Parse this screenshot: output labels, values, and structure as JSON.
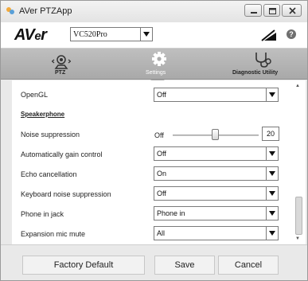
{
  "window": {
    "title": "AVer PTZApp"
  },
  "header": {
    "logo": {
      "main": "AV",
      "small": "e",
      "tail": "r"
    },
    "device": "VC520Pro",
    "help": "?"
  },
  "tabs": [
    {
      "label": "PTZ",
      "icon": "camera-ptz-icon",
      "active": false
    },
    {
      "label": "Settings",
      "icon": "gear-icon",
      "active": true
    },
    {
      "label": "Diagnostic Utility",
      "icon": "stethoscope-icon",
      "active": false
    }
  ],
  "settings": {
    "opengl": {
      "label": "OpenGL",
      "value": "Off"
    },
    "speakerphone_title": "Speakerphone",
    "noise": {
      "label": "Noise suppression",
      "min_label": "Off",
      "value": "20"
    },
    "agc": {
      "label": "Automatically gain control",
      "value": "Off"
    },
    "echo": {
      "label": "Echo cancellation",
      "value": "On"
    },
    "keyboard": {
      "label": "Keyboard noise suppression",
      "value": "Off"
    },
    "phone_jack": {
      "label": "Phone in jack",
      "value": "Phone in"
    },
    "exp_mic": {
      "label": "Expansion mic mute",
      "value": "All"
    }
  },
  "footer": {
    "factory_default": "Factory Default",
    "save": "Save",
    "cancel": "Cancel"
  },
  "colors": {
    "tab_bar": "#b3b3b3",
    "window_bg": "#e9e9e9",
    "content_bg": "#ffffff"
  }
}
